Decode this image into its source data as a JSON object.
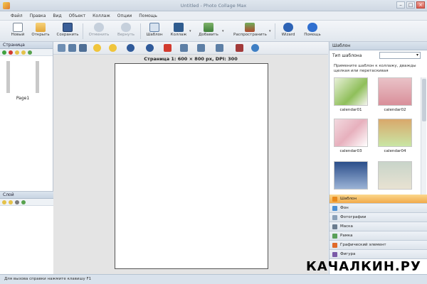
{
  "window": {
    "title": "Untitled - Photo Collage Max"
  },
  "menu": [
    "Файл",
    "Правка",
    "Вид",
    "Объект",
    "Коллаж",
    "Опции",
    "Помощь"
  ],
  "toolbar": [
    {
      "label": "Новый",
      "icon": "new-file-icon",
      "enabled": true
    },
    {
      "label": "Открыть",
      "icon": "open-folder-icon",
      "enabled": true
    },
    {
      "label": "Сохранить",
      "icon": "save-icon",
      "enabled": true
    },
    {
      "label": "Отменить",
      "icon": "undo-icon",
      "enabled": false
    },
    {
      "label": "Вернуть",
      "icon": "redo-icon",
      "enabled": false
    },
    {
      "label": "Шаблон",
      "icon": "template-icon",
      "enabled": true
    },
    {
      "label": "Коллаж",
      "icon": "collage-icon",
      "enabled": true
    },
    {
      "label": "Добавить",
      "icon": "add-image-icon",
      "enabled": true
    },
    {
      "label": "Распространить",
      "icon": "share-icon",
      "enabled": true
    },
    {
      "label": "Wizard",
      "icon": "wizard-icon",
      "enabled": true
    },
    {
      "label": "Помощь",
      "icon": "help-icon",
      "enabled": true
    }
  ],
  "left": {
    "pages_title": "Страница",
    "pages": [
      {
        "label": "Page1"
      }
    ],
    "layers_title": "Слой"
  },
  "workspace": {
    "page_info": "Страница 1: 600 × 800 px, DPI: 300"
  },
  "right": {
    "title": "Шаблон",
    "type_label": "Тип шаблона",
    "type_value": "",
    "hint": "Примените шаблон к коллажу, дважды щелкая или перетаскивая",
    "templates": [
      "calendar01",
      "calendar02",
      "calendar03",
      "calendar04"
    ],
    "categories": [
      {
        "label": "Шаблон",
        "active": true,
        "color": "#e98a1c"
      },
      {
        "label": "Фон",
        "active": false,
        "color": "#4a8fd4"
      },
      {
        "label": "Фотографии",
        "active": false,
        "color": "#8aa0b8"
      },
      {
        "label": "Маска",
        "active": false,
        "color": "#6b7c8e"
      },
      {
        "label": "Рамка",
        "active": false,
        "color": "#5aa05a"
      },
      {
        "label": "Графический элемент",
        "active": false,
        "color": "#e06a2a"
      },
      {
        "label": "Фигура",
        "active": false,
        "color": "#7a5aa8"
      }
    ]
  },
  "status": "Для вызова справки нажмите клавишу F1",
  "watermark": "КАЧАЛКИН.РУ"
}
